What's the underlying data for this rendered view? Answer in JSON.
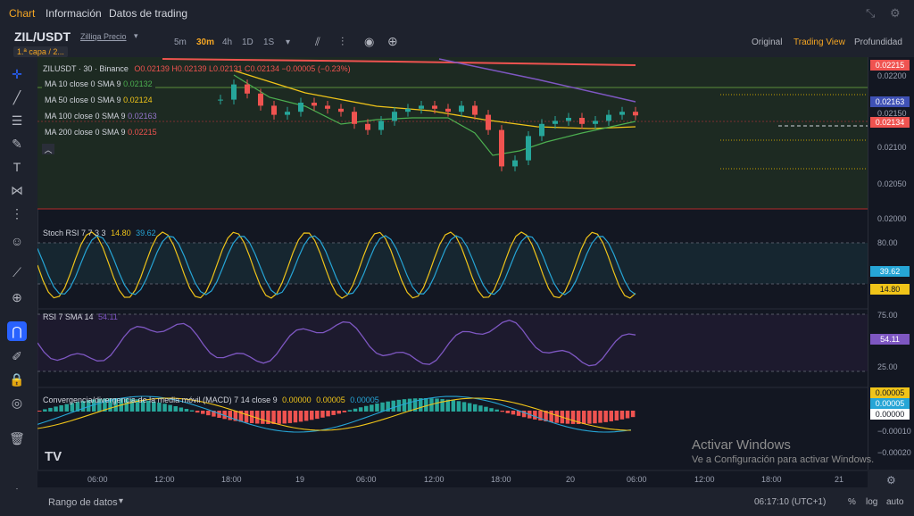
{
  "nav": {
    "tabs": [
      "Chart",
      "Información",
      "Datos de trading"
    ],
    "active": "Chart"
  },
  "header": {
    "symbol": "ZIL/USDT",
    "symbol_desc": "Zilliqa Precio",
    "layer_badge": "1.ª capa / 2...",
    "timeframes": [
      "5m",
      "30m",
      "4h",
      "1D",
      "1S"
    ],
    "active_timeframe": "30m",
    "views": [
      "Original",
      "Trading View",
      "Profundidad"
    ],
    "active_view": "Trading View"
  },
  "main_pane": {
    "title": "ZILUSDT · 30 · Binance",
    "ohlc": "O0.02139 H0.02139 L0.02131 C0.02134 −0.00005 (−0.23%)",
    "mas": [
      {
        "label": "MA 10 close 0 SMA 9",
        "value": "0.02132",
        "color": "#4caf50"
      },
      {
        "label": "MA 50 close 0 SMA 9",
        "value": "0.02124",
        "color": "#f0c419"
      },
      {
        "label": "MA 100 close 0 SMA 9",
        "value": "0.02163",
        "color": "#7e57c2"
      },
      {
        "label": "MA 200 close 0 SMA 9",
        "value": "0.02215",
        "color": "#ef5350"
      }
    ],
    "price_scale": [
      "0.02200",
      "0.02150",
      "0.02100",
      "0.02050",
      "0.02000"
    ],
    "price_labels": [
      {
        "value": "0.02215",
        "color": "#ef5350"
      },
      {
        "value": "0.02163",
        "color": "#3f51b5"
      },
      {
        "value": "0.02134",
        "color": "#ef5350"
      }
    ]
  },
  "stoch_pane": {
    "title": "Stoch RSI 7 7 3 3",
    "k_value": "14.80",
    "d_value": "39.62",
    "scale": [
      "80.00",
      "20.00"
    ]
  },
  "rsi_pane": {
    "title": "RSI 7 SMA 14",
    "value": "54.11",
    "scale": [
      "75.00",
      "50.00",
      "25.00"
    ]
  },
  "macd_pane": {
    "title": "Convergencia/divergencia de la media móvil (MACD) 7 14 close 9",
    "values": [
      "0.00000",
      "0.00005",
      "0.00005"
    ],
    "scale_labels": [
      "0.00005",
      "0.00005",
      "0.00000",
      "−0.00010",
      "−0.00020"
    ]
  },
  "time_axis": [
    "06:00",
    "12:00",
    "18:00",
    "19",
    "06:00",
    "12:00",
    "18:00",
    "20",
    "06:00",
    "12:00",
    "18:00",
    "21"
  ],
  "footer": {
    "range_label": "Rango de datos",
    "clock": "06:17:10 (UTC+1)",
    "pct": "%",
    "log": "log",
    "auto": "auto"
  },
  "watermark": {
    "line1": "Activar Windows",
    "line2": "Ve a Configuración para activar Windows."
  },
  "chart_data": {
    "type": "line",
    "title": "ZILUSDT · 30 · Binance",
    "ylim": [
      0.0198,
      0.0223
    ],
    "close": [
      0.0216,
      0.02185,
      0.0217,
      0.0215,
      0.02135,
      0.0214,
      0.02155,
      0.0215,
      0.02145,
      0.0214,
      0.0212,
      0.0211,
      0.02125,
      0.0214,
      0.02145,
      0.0215,
      0.02145,
      0.0214,
      0.0215,
      0.02135,
      0.0211,
      0.0205,
      0.0206,
      0.021,
      0.0212,
      0.02125,
      0.0213,
      0.0212,
      0.02125,
      0.02135,
      0.0214,
      0.02134
    ]
  }
}
